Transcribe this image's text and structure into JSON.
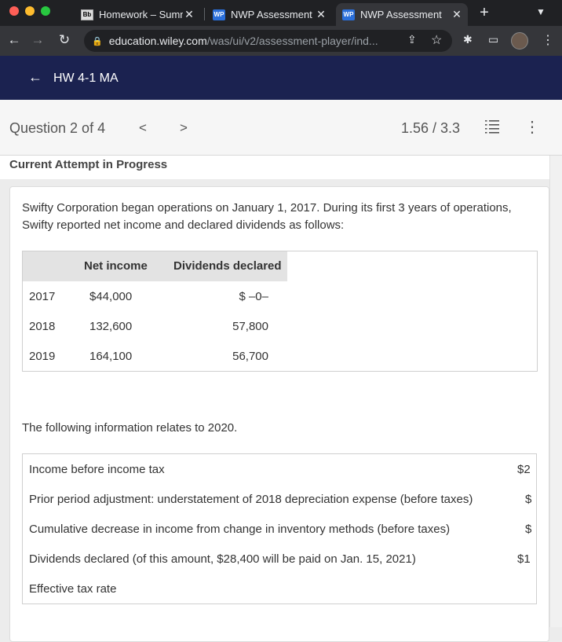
{
  "browser": {
    "tabs": [
      {
        "favicon": "Bb",
        "title": "Homework – Summ",
        "active": false
      },
      {
        "favicon": "WP",
        "title": "NWP Assessment",
        "active": false
      },
      {
        "favicon": "WP",
        "title": "NWP Assessment",
        "active": true
      }
    ],
    "url_host": "education.wiley.com",
    "url_path": "/was/ui/v2/assessment-player/ind..."
  },
  "app": {
    "title": "HW 4-1 MA"
  },
  "question_bar": {
    "label": "Question 2 of 4",
    "score": "1.56 / 3.3"
  },
  "attempt_label": "Current Attempt in Progress",
  "intro_text": "Swifty Corporation began operations on January 1, 2017. During its first 3 years of operations, Swifty reported net income and declared dividends as follows:",
  "table1": {
    "headers": {
      "net_income": "Net income",
      "dividends": "Dividends declared"
    },
    "rows": [
      {
        "year": "2017",
        "net_income": "$44,000",
        "dividends": "$ –0–"
      },
      {
        "year": "2018",
        "net_income": "132,600",
        "dividends": "57,800"
      },
      {
        "year": "2019",
        "net_income": "164,100",
        "dividends": "56,700"
      }
    ]
  },
  "following_text": "The following information relates to 2020.",
  "table2": {
    "rows": [
      {
        "label": "Income before income tax",
        "value": "$2"
      },
      {
        "label": "Prior period adjustment: understatement of 2018 depreciation expense (before taxes)",
        "value": "$"
      },
      {
        "label": "Cumulative decrease in income from change in inventory methods (before taxes)",
        "value": "$"
      },
      {
        "label": "Dividends declared (of this amount, $28,400 will be paid on Jan. 15, 2021)",
        "value": "$1"
      },
      {
        "label": "Effective tax rate",
        "value": ""
      }
    ]
  },
  "colors": {
    "appbar": "#1b2250",
    "chrome_dark": "#202124",
    "chrome_toolbar": "#35363a"
  }
}
